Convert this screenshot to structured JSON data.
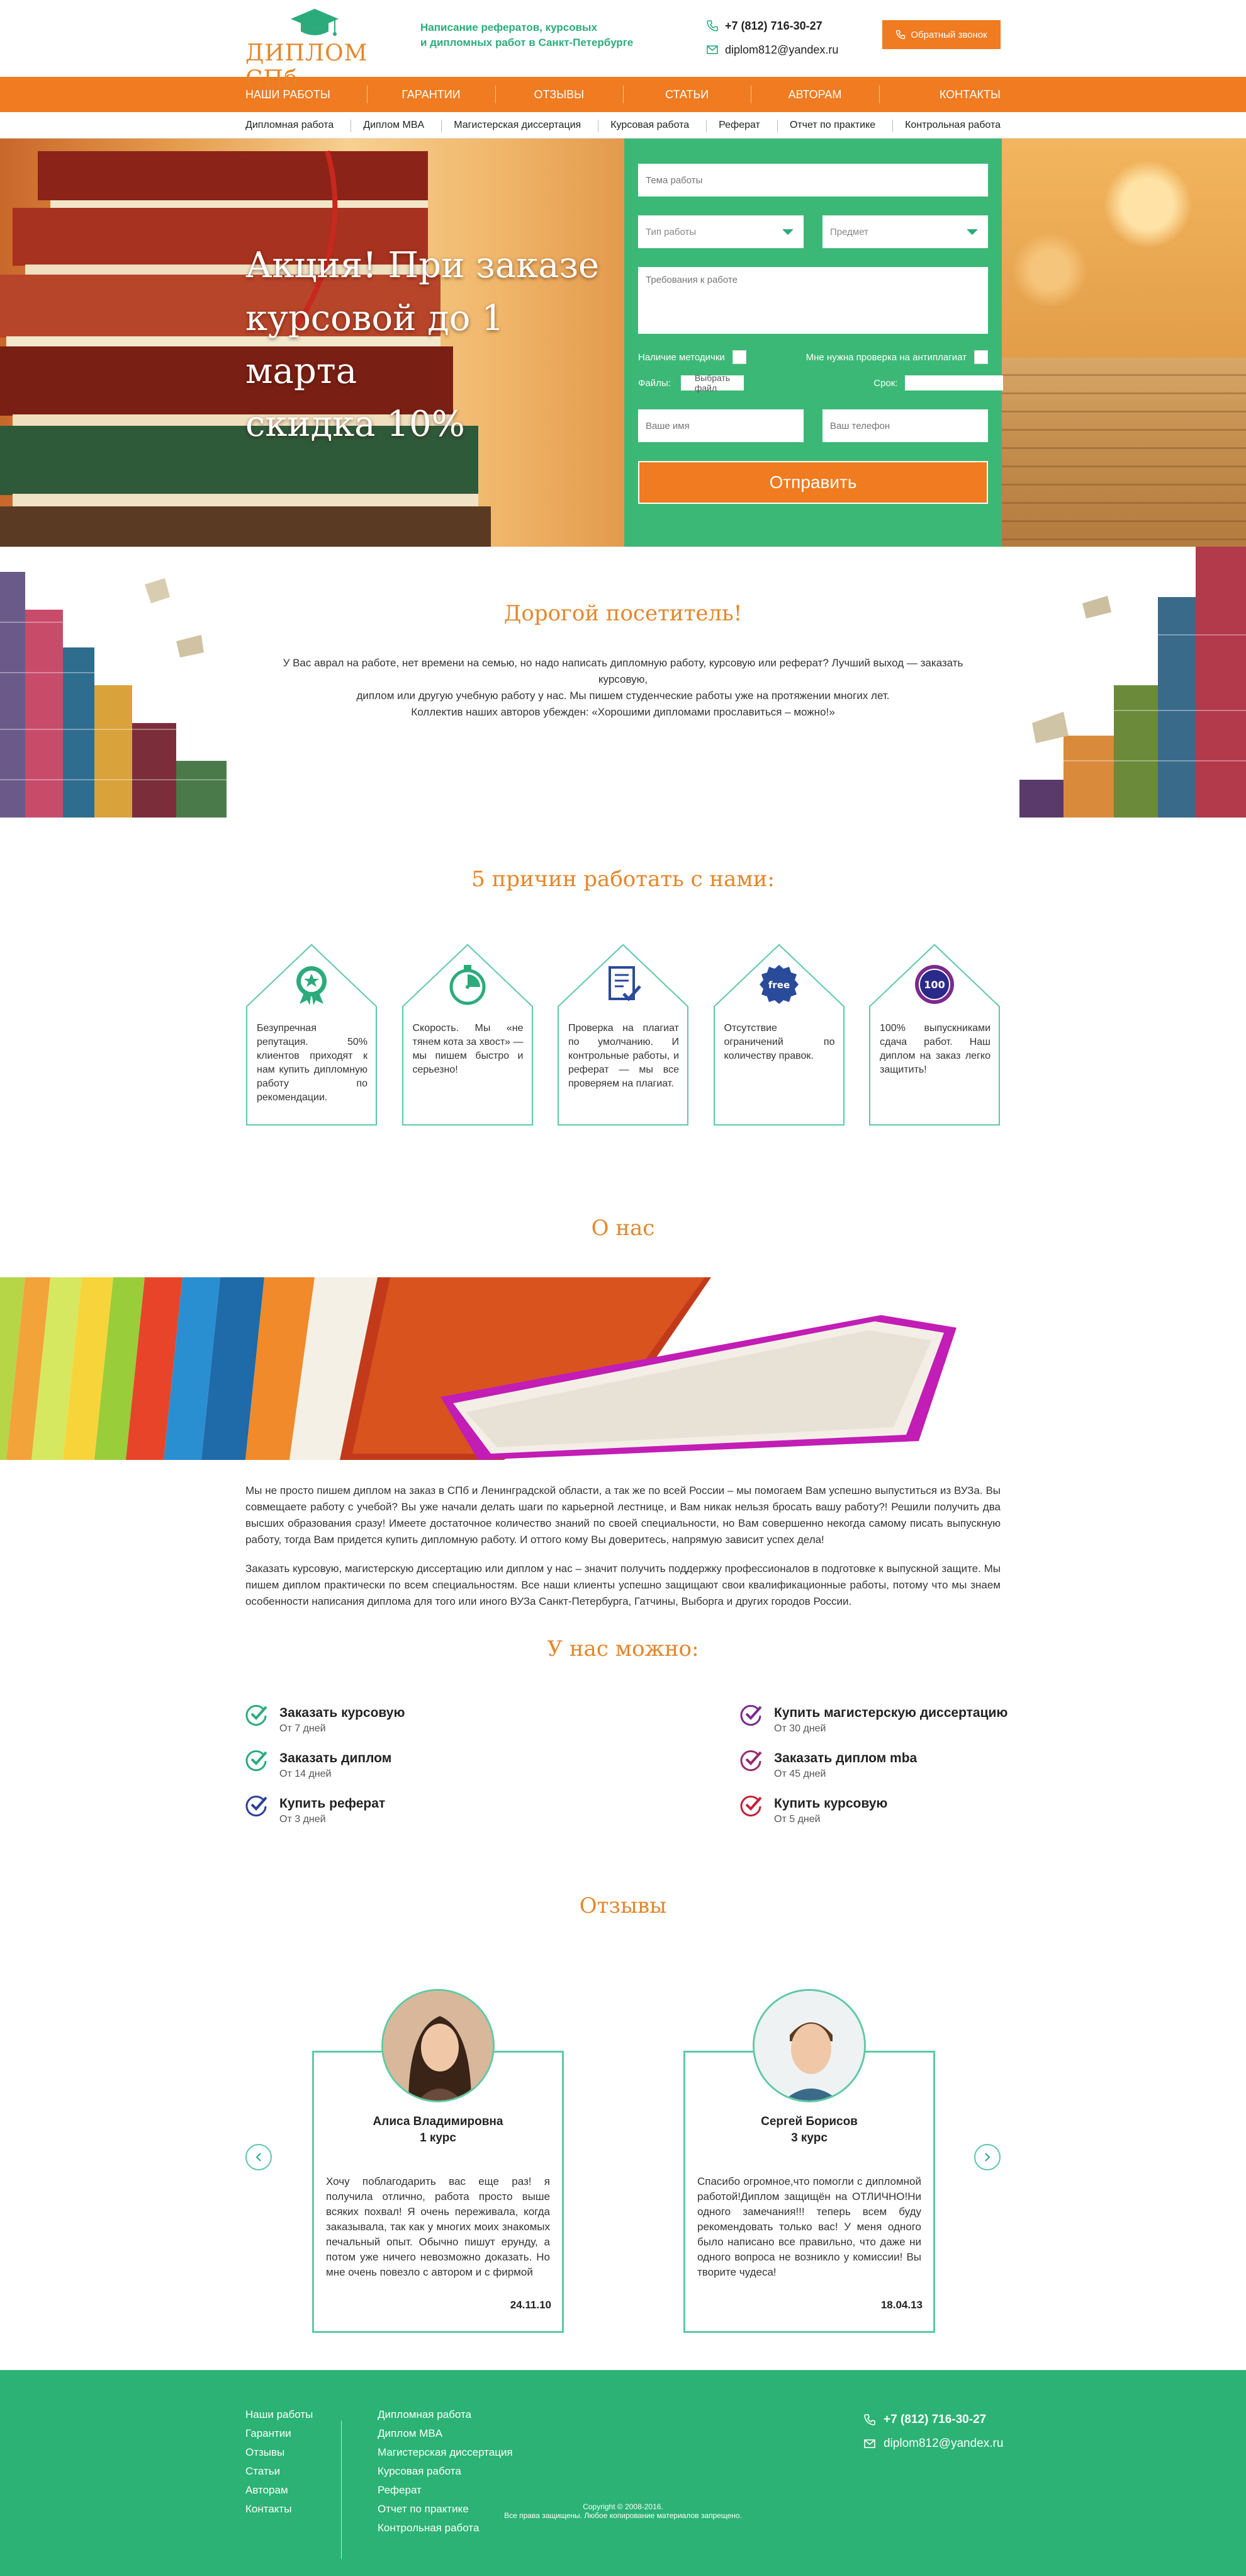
{
  "header": {
    "logo_text": "ДИПЛОМ СПб",
    "tagline_line1": "Написание рефератов, курсовых",
    "tagline_line2": "и дипломных работ в Санкт-Петербурге",
    "phone": "+7 (812) 716-30-27",
    "email": "diplom812@yandex.ru",
    "callback_label": "Обратный звонок",
    "icons": {
      "phone": "phone-icon",
      "email": "envelope-icon",
      "callback": "phone-icon"
    }
  },
  "nav": {
    "items": [
      {
        "label": "Наши работы"
      },
      {
        "label": "Гарантии"
      },
      {
        "label": "Отзывы"
      },
      {
        "label": "Статьи"
      },
      {
        "label": "Авторам"
      },
      {
        "label": "Контакты"
      }
    ]
  },
  "subnav": {
    "items": [
      {
        "label": "Дипломная работа"
      },
      {
        "label": "Диплом MBA"
      },
      {
        "label": "Магистерская диссертация"
      },
      {
        "label": "Курсовая работа"
      },
      {
        "label": "Реферат"
      },
      {
        "label": "Отчет по практике"
      },
      {
        "label": "Контрольная работа"
      }
    ]
  },
  "hero": {
    "promo_line1": "Акция! При заказе",
    "promo_line2": "курсовой до 1 марта",
    "promo_line3": "скидка 10%",
    "form": {
      "topic_placeholder": "Тема работы",
      "type_placeholder": "Тип работы",
      "subject_placeholder": "Предмет",
      "requirements_placeholder": "Требования к работе",
      "methods_label": "Наличие методички",
      "antiplagiat_label": "Мне нужна проверка на антиплагиат",
      "files_label": "Файлы:",
      "choose_file_label": "Выбрать файл",
      "deadline_label": "Срок:",
      "name_placeholder": "Ваше имя",
      "phone_placeholder": "Ваш телефон",
      "submit_label": "Отправить"
    }
  },
  "welcome": {
    "title": "Дорогой посетитель!",
    "line1": "У Вас аврал на работе, нет времени на семью, но надо написать дипломную работу, курсовую или реферат? Лучший выход — заказать курсовую,",
    "line2": "диплом или другую учебную работу у нас. Мы пишем студенческие работы уже на протяжении многих лет.",
    "line3": "Коллектив наших авторов убежден: «Хорошими дипломами прославиться – можно!»"
  },
  "reasons": {
    "title": "5 причин работать с нами:",
    "cards": [
      {
        "icon": "ribbon-star-icon",
        "text": "Безупречная репутация. 50% клиентов приходят к нам купить дипломную работу по рекомендации."
      },
      {
        "icon": "stopwatch-icon",
        "text": "Скорость. Мы «не тянем кота за хвост» — мы пишем быстро и серьезно!"
      },
      {
        "icon": "document-check-icon",
        "text": "Проверка на плагиат по умолчанию. И контрольные работы, и реферат — мы все проверяем на плагиат."
      },
      {
        "icon": "free-badge-icon",
        "badge_text": "free",
        "text": "Отсутствие ограничений по количеству правок."
      },
      {
        "icon": "hundred-badge-icon",
        "badge_text": "100",
        "text": "100% выпускниками сдача работ. Наш диплом на заказ легко защитить!"
      }
    ]
  },
  "about": {
    "title": "О нас",
    "p1": "Мы не просто пишем диплом на заказ в СПб и Ленинградской области, а так же по всей России – мы помогаем Вам успешно выпуститься из ВУЗа. Вы совмещаете работу с учебой? Вы уже начали делать шаги по карьерной лестнице, и Вам никак нельзя бросать вашу работу?! Решили получить два высших образования сразу! Имеете достаточное количество знаний по своей специальности, но Вам совершенно некогда самому писать выпускную работу, тогда Вам придется купить дипломную работу. И оттого кому Вы доверитесь, напрямую зависит успех дела!",
    "p2": "Заказать курсовую, магистерскую диссертацию или диплом у нас – значит получить поддержку профессионалов в подготовке к выпускной защите. Мы пишем диплом практически по всем специальностям. Все наши клиенты успешно защищают свои квалификационные работы, потому что мы знаем особенности написания диплома для того или иного ВУЗа Санкт-Петербурга, Гатчины, Выборга и других городов России."
  },
  "services": {
    "title": "У нас можно:",
    "left": [
      {
        "title": "Заказать курсовую",
        "sub": "От 7 дней",
        "color": "#2bab7c"
      },
      {
        "title": "Заказать диплом",
        "sub": "От 14 дней",
        "color": "#2bab7c"
      },
      {
        "title": "Купить реферат",
        "sub": "От 3 дней",
        "color": "#2a3f9a"
      }
    ],
    "right": [
      {
        "title": "Купить магистерскую диссертацию",
        "sub": "От 30 дней",
        "color": "#7b2a8c"
      },
      {
        "title": "Заказать диплом mba",
        "sub": "От 45 дней",
        "color": "#9a2a6e"
      },
      {
        "title": "Купить курсовую",
        "sub": "От 5 дней",
        "color": "#c5213a"
      }
    ]
  },
  "reviews": {
    "title": "Отзывы",
    "items": [
      {
        "name": "Алиса Владимировна",
        "course": "1 курс",
        "text": "Хочу поблагодарить вас еще раз! я получила отлично, работа просто выше всяких похвал! Я очень переживала, когда заказывала, так как у многих моих знакомых печальный опыт. Обычно пишут ерунду, а потом уже ничего невозможно доказать. Но мне очень повезло с автором и с фирмой",
        "date": "24.11.10"
      },
      {
        "name": "Сергей Борисов",
        "course": "3 курс",
        "text": "Спасибо огромное,что помогли с дипломной работой!Диплом защищён на ОТЛИЧНО!Ни одного замечания!!! теперь всем буду рекомендовать только вас! У меня одного было написано все правильно, что даже ни одного вопроса не возникло у комиссии! Вы творите чудеса!",
        "date": "18.04.13"
      }
    ]
  },
  "footer": {
    "col1": [
      "Наши работы",
      "Гарантии",
      "Отзывы",
      "Статьи",
      "Авторам",
      "Контакты"
    ],
    "col2": [
      "Дипломная работа",
      "Диплом MBA",
      "Магистерская диссертация",
      "Курсовая работа",
      "Реферат",
      "Отчет по практике",
      "Контрольная работа"
    ],
    "phone": "+7 (812) 716-30-27",
    "email": "diplom812@yandex.ru",
    "copyright_line1": "Copyright © 2008-2016.",
    "copyright_line2": "Все права защищены. Любое копирование материалов запрещено."
  },
  "colors": {
    "orange": "#f07b20",
    "green": "#3cb876",
    "dark_green": "#2bab7c",
    "title_orange": "#e4862a"
  }
}
